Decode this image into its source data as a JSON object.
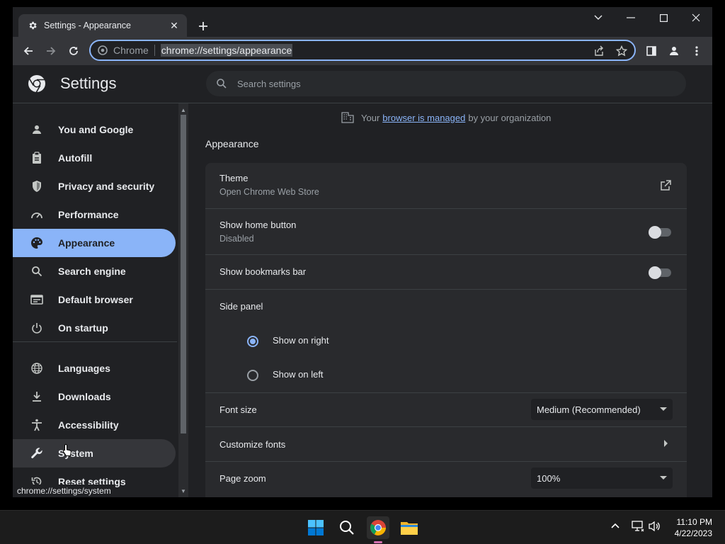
{
  "tab": {
    "title": "Settings - Appearance",
    "close": "✕"
  },
  "omnibox": {
    "site": "Chrome",
    "url": "chrome://settings/appearance"
  },
  "header": {
    "title": "Settings",
    "search_placeholder": "Search settings"
  },
  "sidebar": {
    "items": [
      {
        "label": "You and Google",
        "icon": "person-icon"
      },
      {
        "label": "Autofill",
        "icon": "clipboard-icon"
      },
      {
        "label": "Privacy and security",
        "icon": "shield-icon"
      },
      {
        "label": "Performance",
        "icon": "speedometer-icon"
      },
      {
        "label": "Appearance",
        "icon": "palette-icon"
      },
      {
        "label": "Search engine",
        "icon": "search-icon"
      },
      {
        "label": "Default browser",
        "icon": "browser-icon"
      },
      {
        "label": "On startup",
        "icon": "power-icon"
      },
      {
        "label": "Languages",
        "icon": "globe-icon"
      },
      {
        "label": "Downloads",
        "icon": "download-icon"
      },
      {
        "label": "Accessibility",
        "icon": "accessibility-icon"
      },
      {
        "label": "System",
        "icon": "wrench-icon"
      },
      {
        "label": "Reset settings",
        "icon": "reset-icon"
      }
    ],
    "active_index": 4
  },
  "statusbar": {
    "url": "chrome://settings/system"
  },
  "managed": {
    "prefix": "Your",
    "link": "browser is managed",
    "suffix": "by your organization"
  },
  "appearance": {
    "heading": "Appearance",
    "theme": {
      "label": "Theme",
      "sub": "Open Chrome Web Store"
    },
    "home_button": {
      "label": "Show home button",
      "sub": "Disabled",
      "enabled": false
    },
    "bookmarks_bar": {
      "label": "Show bookmarks bar",
      "enabled": false
    },
    "side_panel": {
      "label": "Side panel",
      "options": [
        "Show on right",
        "Show on left"
      ],
      "selected": "Show on right"
    },
    "font_size": {
      "label": "Font size",
      "value": "Medium (Recommended)"
    },
    "customize_fonts": {
      "label": "Customize fonts"
    },
    "page_zoom": {
      "label": "Page zoom",
      "value": "100%"
    }
  },
  "taskbar": {
    "time": "11:10 PM",
    "date": "4/22/2023"
  },
  "colors": {
    "accent": "#8ab4f8",
    "background": "#202124",
    "card": "#292a2d"
  }
}
